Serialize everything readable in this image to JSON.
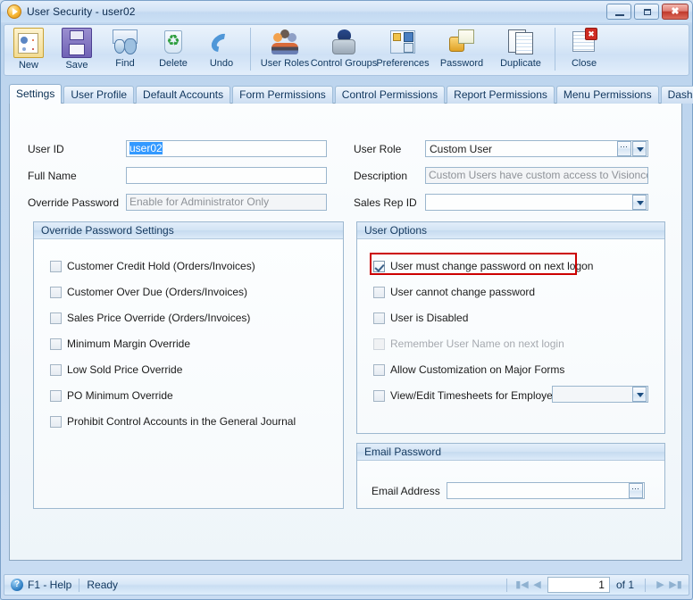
{
  "window": {
    "title": "User Security - user02",
    "icon": "play-circle-icon",
    "buttons": {
      "minimize": "minimize-icon",
      "maximize": "maximize-icon",
      "close": "✖"
    }
  },
  "toolbar": {
    "items": [
      {
        "label": "New",
        "icon": "new-record-icon",
        "cls": "ico-new"
      },
      {
        "label": "Save",
        "icon": "save-disk-icon",
        "cls": "ico-save"
      },
      {
        "label": "Find",
        "icon": "find-binoculars-icon",
        "cls": "ico-find"
      },
      {
        "label": "Delete",
        "icon": "delete-trash-icon",
        "cls": "ico-delete"
      },
      {
        "label": "Undo",
        "icon": "undo-arrow-icon",
        "cls": "ico-undo"
      }
    ],
    "items2": [
      {
        "label": "User Roles",
        "icon": "user-roles-icon",
        "cls": "ico-roles"
      },
      {
        "label": "Control Groups",
        "icon": "control-groups-icon",
        "cls": "ico-cg"
      },
      {
        "label": "Preferences",
        "icon": "preferences-icon",
        "cls": "ico-pref"
      },
      {
        "label": "Password",
        "icon": "password-lock-icon",
        "cls": "ico-pw"
      },
      {
        "label": "Duplicate",
        "icon": "duplicate-icon",
        "cls": "ico-dup"
      }
    ],
    "items3": [
      {
        "label": "Close",
        "icon": "close-window-icon",
        "cls": "ico-close2"
      }
    ]
  },
  "tabs": [
    {
      "label": "Settings",
      "active": true
    },
    {
      "label": "User Profile",
      "active": false
    },
    {
      "label": "Default Accounts",
      "active": false
    },
    {
      "label": "Form Permissions",
      "active": false
    },
    {
      "label": "Control Permissions",
      "active": false
    },
    {
      "label": "Report Permissions",
      "active": false
    },
    {
      "label": "Menu Permissions",
      "active": false
    },
    {
      "label": "Dashboard Permissions",
      "active": false
    }
  ],
  "fields": {
    "user_id": {
      "label": "User ID",
      "value": "user02",
      "selected": true
    },
    "full_name": {
      "label": "Full Name",
      "value": ""
    },
    "override_password": {
      "label": "Override Password",
      "value": "Enable for Administrator Only",
      "readonly": true
    },
    "user_role": {
      "label": "User Role",
      "value": "Custom User"
    },
    "description": {
      "label": "Description",
      "value": "Custom Users have custom access to Visioncore",
      "readonly": true
    },
    "sales_rep_id": {
      "label": "Sales Rep ID",
      "value": ""
    }
  },
  "override_password_settings": {
    "title": "Override Password Settings",
    "options": [
      {
        "label": "Customer Credit Hold (Orders/Invoices)",
        "checked": false,
        "disabled": false
      },
      {
        "label": "Customer Over Due (Orders/Invoices)",
        "checked": false,
        "disabled": false
      },
      {
        "label": "Sales Price Override (Orders/Invoices)",
        "checked": false,
        "disabled": false
      },
      {
        "label": "Minimum Margin Override",
        "checked": false,
        "disabled": false
      },
      {
        "label": "Low Sold Price Override",
        "checked": false,
        "disabled": false
      },
      {
        "label": "PO Minimum Override",
        "checked": false,
        "disabled": false
      },
      {
        "label": "Prohibit Control Accounts in the General Journal",
        "checked": false,
        "disabled": false
      }
    ]
  },
  "user_options": {
    "title": "User Options",
    "options": [
      {
        "label": "User must change password on next logon",
        "checked": true,
        "disabled": false,
        "highlighted": true
      },
      {
        "label": "User cannot change password",
        "checked": false,
        "disabled": false,
        "highlighted": false
      },
      {
        "label": "User is Disabled",
        "checked": false,
        "disabled": false,
        "highlighted": false
      },
      {
        "label": "Remember User Name on next login",
        "checked": false,
        "disabled": true,
        "highlighted": false
      },
      {
        "label": "Allow Customization on Major Forms",
        "checked": false,
        "disabled": false,
        "highlighted": false
      },
      {
        "label": "View/Edit Timesheets for Employee",
        "checked": false,
        "disabled": false,
        "highlighted": false
      }
    ],
    "employee_dropdown_value": ""
  },
  "email_password": {
    "title": "Email Password",
    "email_label": "Email Address",
    "email_value": ""
  },
  "statusbar": {
    "help": "F1 - Help",
    "status": "Ready",
    "page": "1",
    "of": "of 1",
    "first_icon": "first-record-icon",
    "prev_icon": "previous-record-icon",
    "next_icon": "next-record-icon",
    "last_icon": "last-record-icon"
  },
  "colors": {
    "highlight_red": "#cc0000",
    "selection_blue": "#3399ff",
    "title_blue": "#14395f"
  }
}
